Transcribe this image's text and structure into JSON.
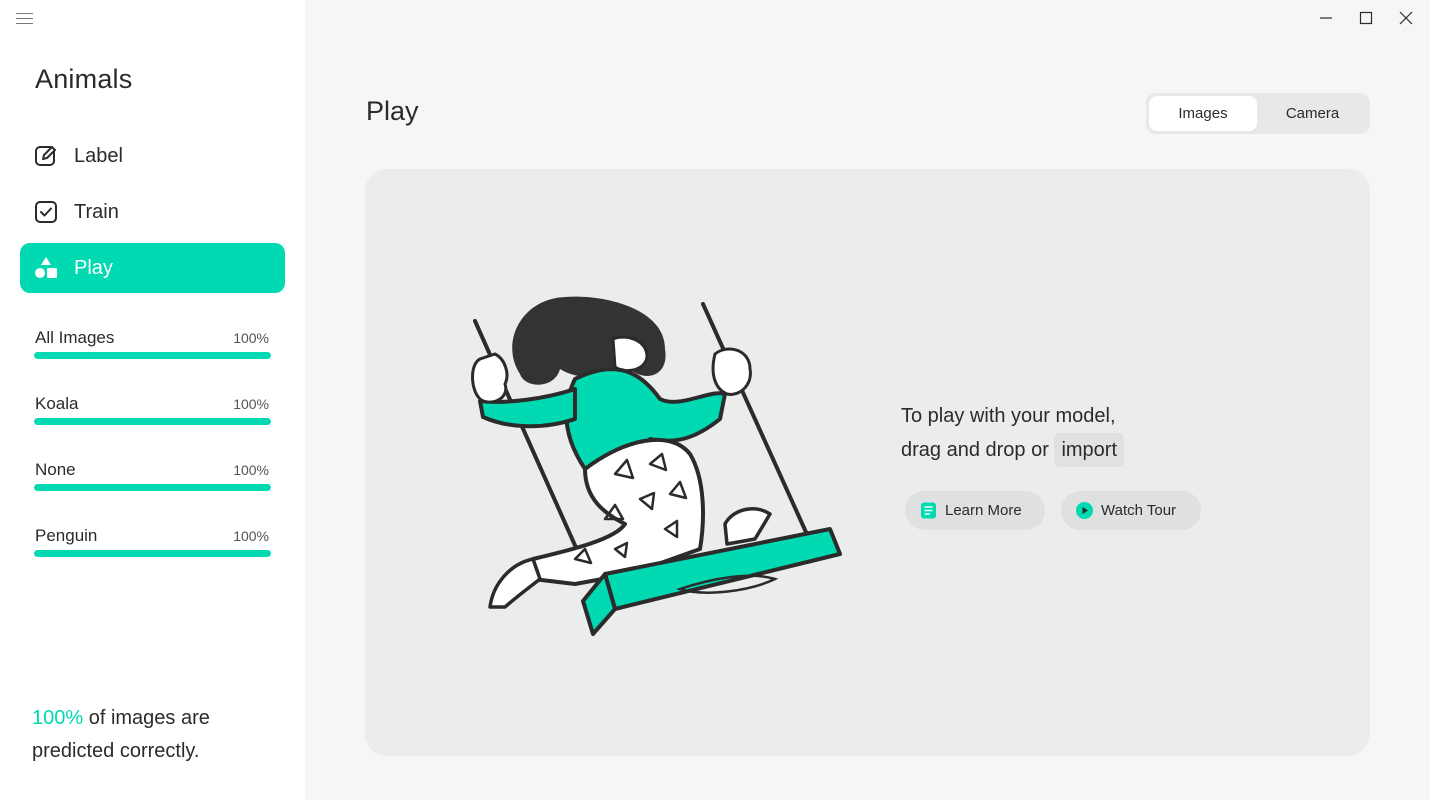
{
  "app": {
    "project_title": "Animals"
  },
  "nav": {
    "items": [
      {
        "label": "Label",
        "icon": "pencil-square-icon",
        "active": false
      },
      {
        "label": "Train",
        "icon": "checkbox-icon",
        "active": false
      },
      {
        "label": "Play",
        "icon": "shapes-icon",
        "active": true
      }
    ]
  },
  "label_stats": [
    {
      "name": "All Images",
      "percent_text": "100%",
      "value": 1.0
    },
    {
      "name": "Koala",
      "percent_text": "100%",
      "value": 1.0
    },
    {
      "name": "None",
      "percent_text": "100%",
      "value": 1.0
    },
    {
      "name": "Penguin",
      "percent_text": "100%",
      "value": 1.0
    }
  ],
  "summary": {
    "percent": "100%",
    "text_line1": " of images are",
    "text_line2": "predicted correctly."
  },
  "main": {
    "title": "Play",
    "source_toggle": {
      "options": [
        "Images",
        "Camera"
      ],
      "selected": "Images"
    },
    "prompt_line1": "To play with your model,",
    "prompt_line2": "drag and drop or",
    "import_label": "import",
    "learn_more_label": "Learn More",
    "watch_tour_label": "Watch Tour"
  },
  "colors": {
    "accent": "#00d9b2",
    "sidebar_bg": "#ffffff",
    "page_bg": "#f5f6f7",
    "panel_bg": "#ebecec"
  }
}
